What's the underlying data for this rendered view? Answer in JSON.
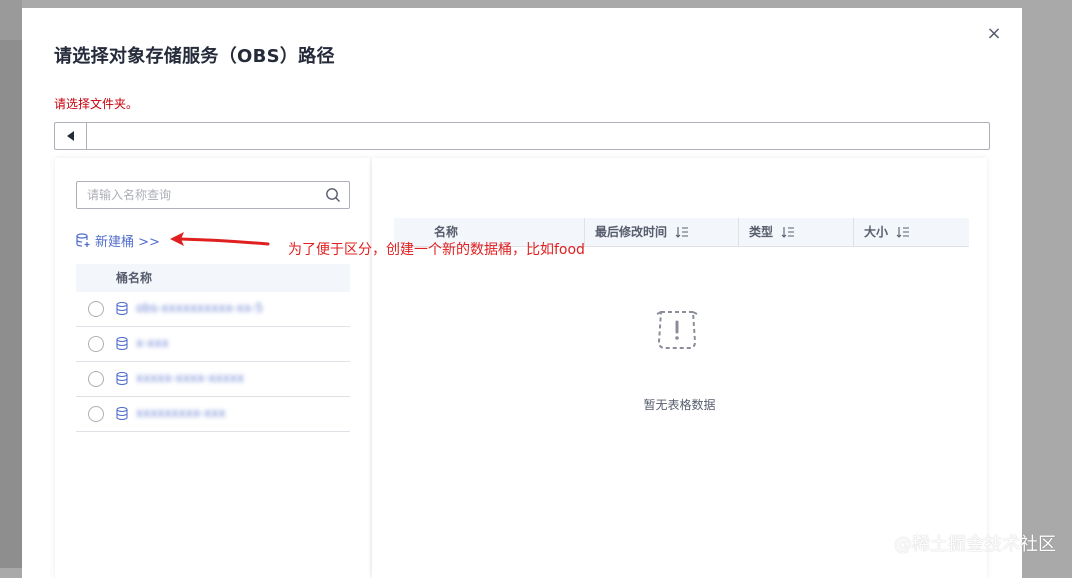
{
  "dialog": {
    "title": "请选择对象存储服务（OBS）路径",
    "hint": "请选择文件夹。",
    "close_glyph": "×",
    "path_value": ""
  },
  "left_panel": {
    "search_placeholder": "请输入名称查询",
    "new_bucket_label": "新建桶 >>",
    "bucket_table": {
      "header": "桶名称",
      "rows": [
        {
          "name": "obs-xxxxxxxxxx-xx-5"
        },
        {
          "name": "x-xxx"
        },
        {
          "name": "xxxxx-xxxx-xxxxx"
        },
        {
          "name": "xxxxxxxxx-xxx"
        }
      ]
    }
  },
  "right_panel": {
    "columns": [
      "名称",
      "最后修改时间",
      "类型",
      "大小"
    ],
    "empty_text": "暂无表格数据"
  },
  "annotation": {
    "text": "为了便于区分，创建一个新的数据桶，比如food",
    "color": "#e02020"
  },
  "watermark": "@稀土掘金技术社区",
  "colors": {
    "link": "#526ecc",
    "hint": "#c7000b",
    "border": "#adb0b8",
    "header_bg": "#f3f6fb"
  },
  "icons": {
    "close": "close-icon",
    "back": "triangle-left-icon",
    "search": "search-icon",
    "new_bucket": "bucket-add-icon",
    "bucket": "database-icon",
    "sort": "sort-icon",
    "empty": "empty-data-icon"
  }
}
